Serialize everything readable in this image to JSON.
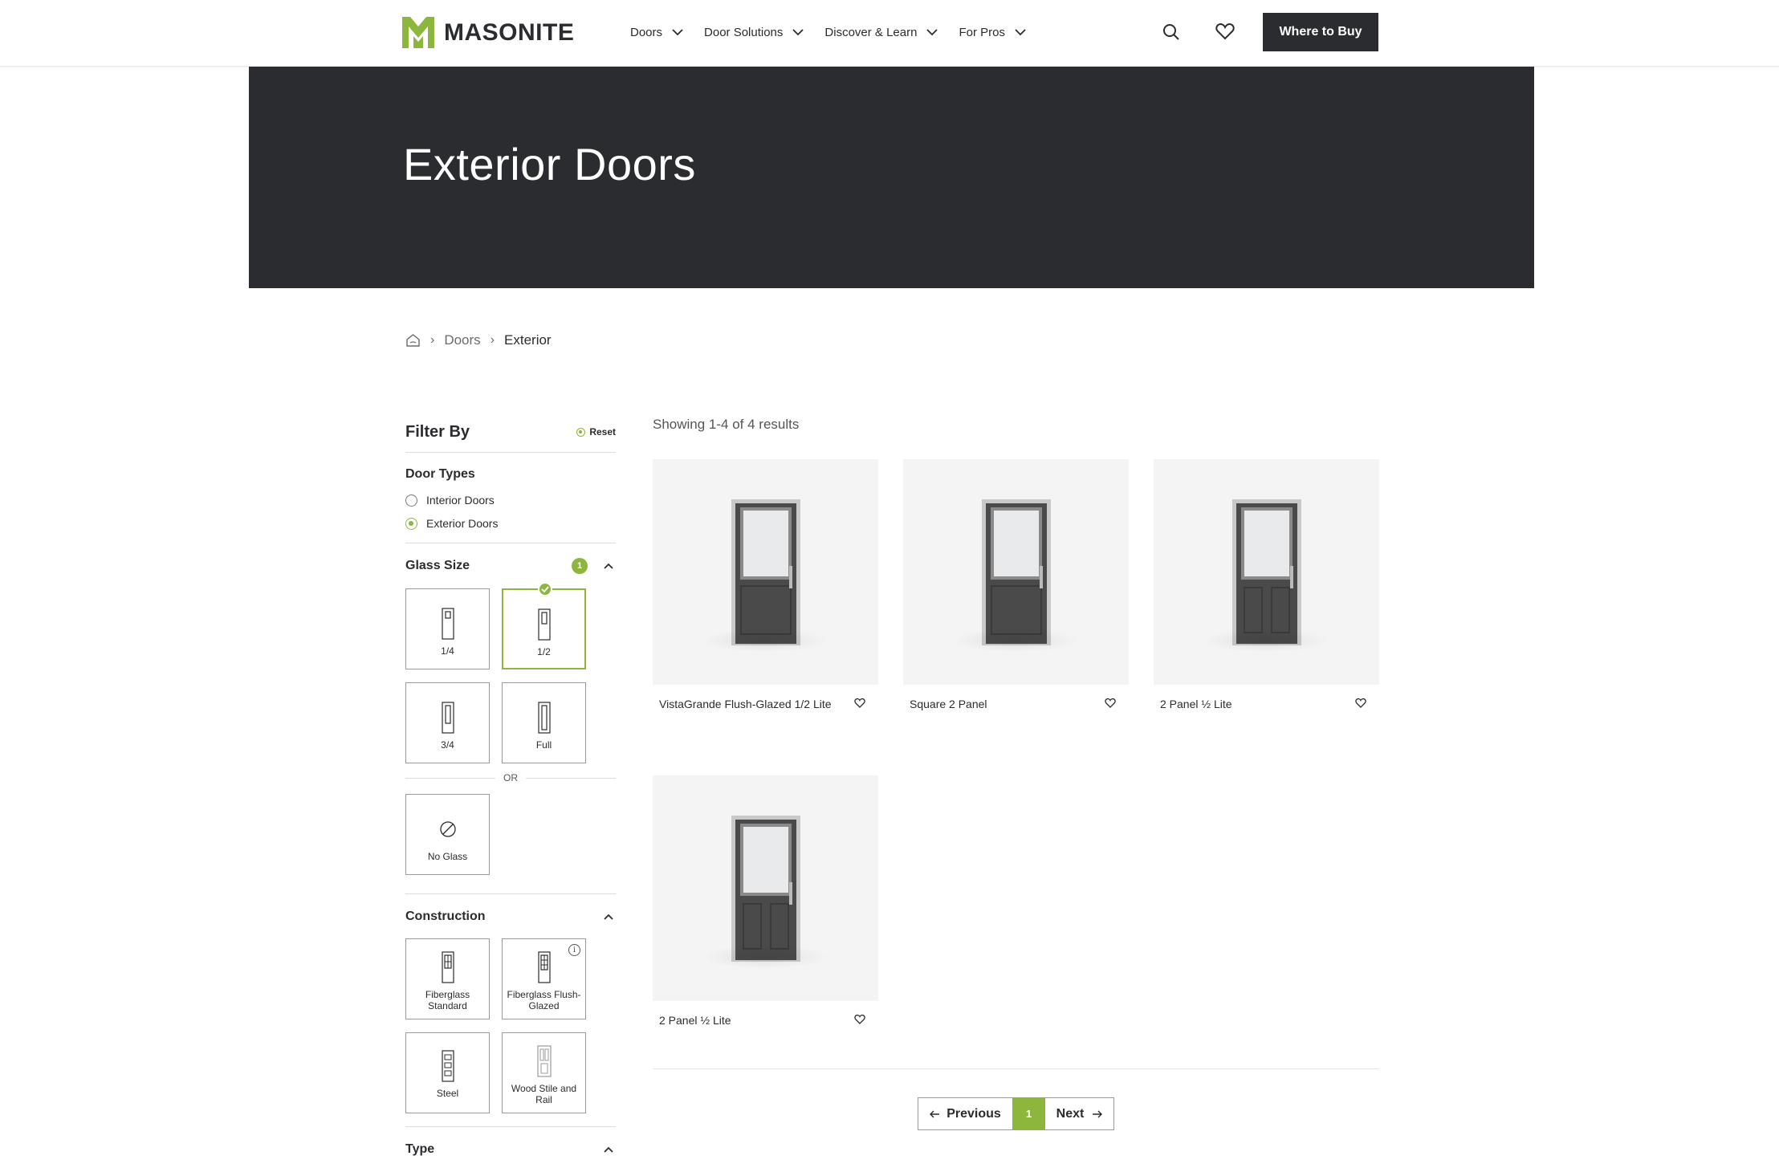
{
  "header": {
    "brand": "MASONITE",
    "nav": [
      {
        "label": "Doors"
      },
      {
        "label": "Door Solutions"
      },
      {
        "label": "Discover & Learn"
      },
      {
        "label": "For Pros"
      }
    ],
    "cta_label": "Where to Buy"
  },
  "hero": {
    "title": "Exterior Doors"
  },
  "breadcrumb": {
    "items": [
      "Doors",
      "Exterior"
    ]
  },
  "filters": {
    "title": "Filter By",
    "reset_label": "Reset",
    "door_types": {
      "title": "Door Types",
      "options": [
        {
          "label": "Interior Doors",
          "selected": false
        },
        {
          "label": "Exterior Doors",
          "selected": true
        }
      ]
    },
    "glass_size": {
      "title": "Glass Size",
      "count": "1",
      "options": [
        {
          "label": "1/4",
          "selected": false
        },
        {
          "label": "1/2",
          "selected": true
        },
        {
          "label": "3/4",
          "selected": false
        },
        {
          "label": "Full",
          "selected": false
        }
      ],
      "or_label": "OR",
      "no_glass_label": "No Glass"
    },
    "construction": {
      "title": "Construction",
      "options": [
        {
          "label": "Fiberglass Standard"
        },
        {
          "label": "Fiberglass Flush-Glazed"
        },
        {
          "label": "Steel"
        },
        {
          "label": "Wood Stile and Rail"
        }
      ]
    },
    "type": {
      "title": "Type"
    }
  },
  "results": {
    "summary": "Showing 1-4 of 4 results",
    "products": [
      {
        "name": "VistaGrande Flush-Glazed 1/2 Lite",
        "panel": "single"
      },
      {
        "name": "Square 2 Panel",
        "panel": "single"
      },
      {
        "name": "2 Panel ½ Lite",
        "panel": "double"
      },
      {
        "name": "2 Panel ½ Lite",
        "panel": "double"
      }
    ]
  },
  "pagination": {
    "prev_label": "Previous",
    "current_page": "1",
    "next_label": "Next"
  },
  "colors": {
    "accent": "#8db63c",
    "dark": "#2b2c2f",
    "hero_bg": "#2b2c2f"
  }
}
